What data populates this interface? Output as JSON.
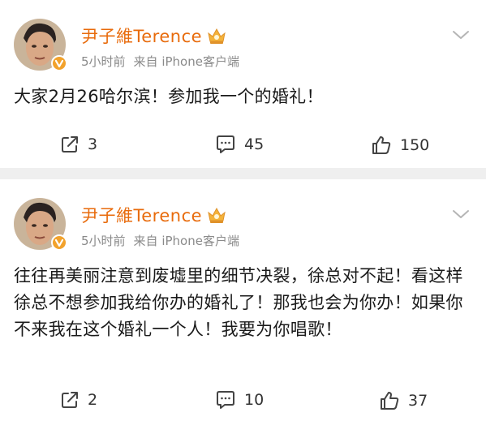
{
  "posts": [
    {
      "username": "尹子維Terence",
      "time": "5小时前",
      "source": "来自 iPhone客户端",
      "text": "大家2月26哈尔滨！参加我一个的婚礼！",
      "reposts": "3",
      "comments": "45",
      "likes": "150"
    },
    {
      "username": "尹子維Terence",
      "time": "5小时前",
      "source": "来自 iPhone客户端",
      "text": "往往再美丽注意到废墟里的细节决裂，徐总对不起！看这样徐总不想参加我给你办的婚礼了！那我也会为你办！如果你不来我在这个婚礼一个人！我要为你唱歌！",
      "reposts": "2",
      "comments": "10",
      "likes": "37"
    }
  ],
  "icons": {
    "verified": "verified-v-badge-icon",
    "member": "member-crown-icon",
    "more": "chevron-down-icon",
    "repost": "repost-icon",
    "comment": "comment-icon",
    "like": "thumbs-up-icon"
  },
  "colors": {
    "username": "#e86b0c",
    "meta": "#8a8a8a",
    "badge": "#f2a22c",
    "background": "#efefef"
  }
}
